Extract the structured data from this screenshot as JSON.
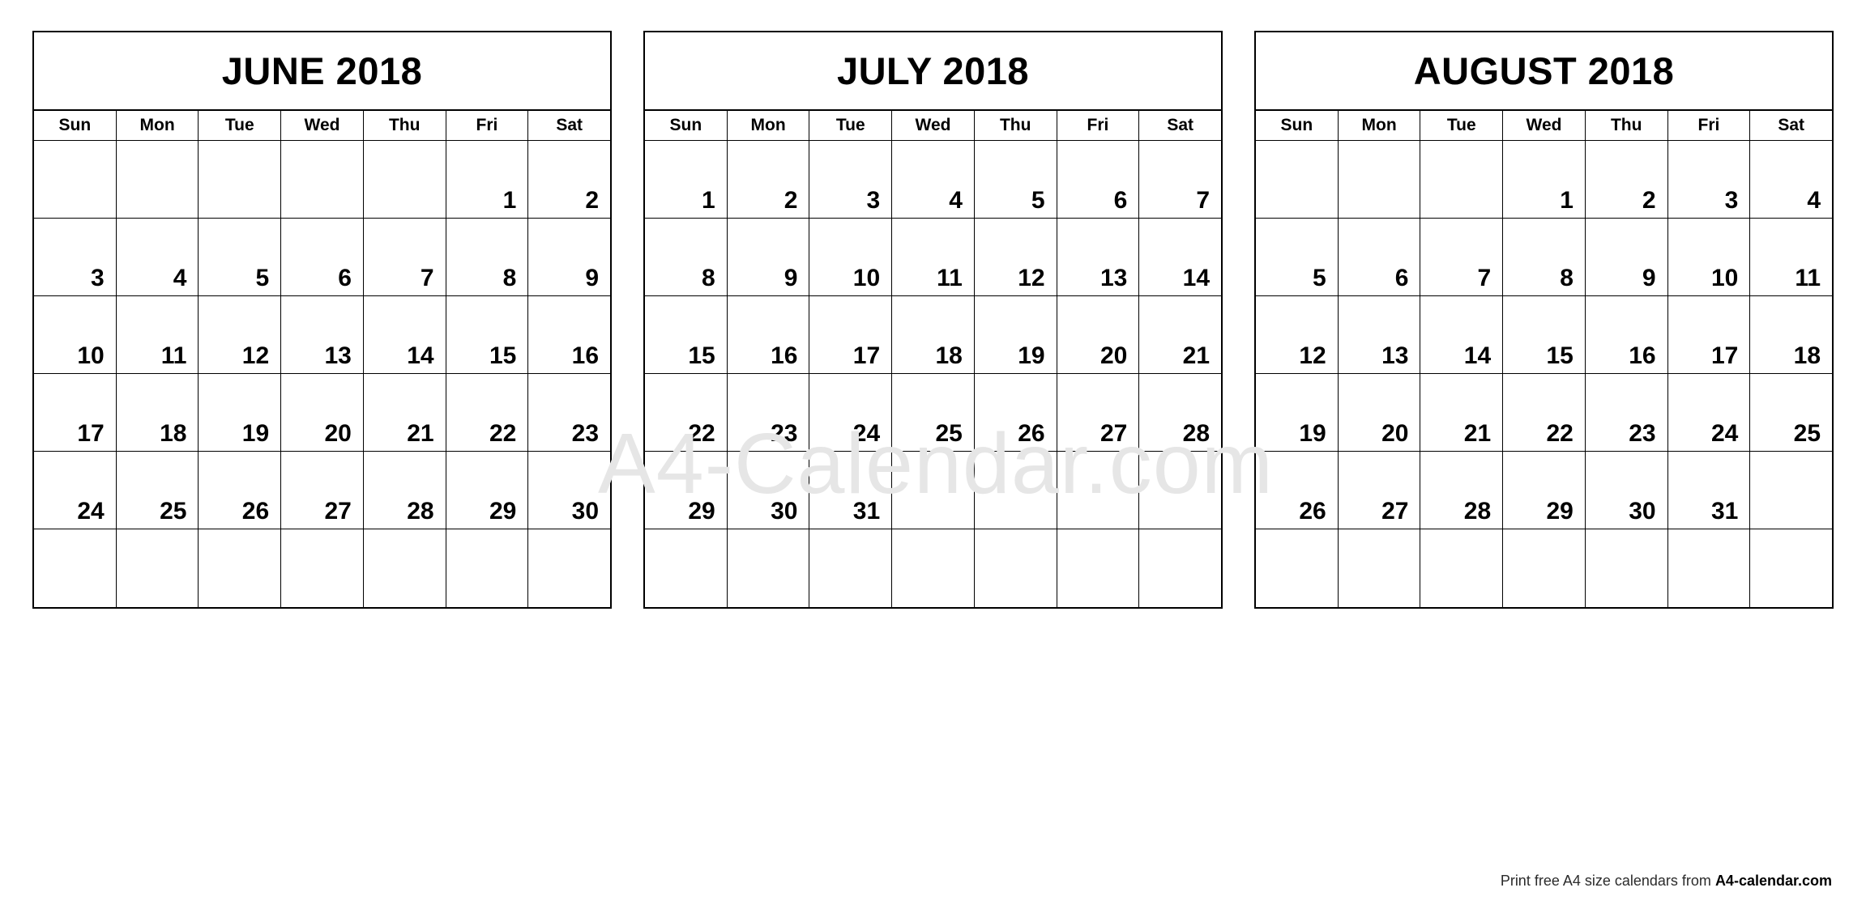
{
  "page": {
    "background_color": "#ffffff",
    "border_color": "#000000"
  },
  "watermark": {
    "text": "A4-Calendar.com",
    "color": "#e6e6e6"
  },
  "footer": {
    "prefix": "Print free A4 size calendars from ",
    "brand": "A4-calendar.com"
  },
  "weekdays": [
    "Sun",
    "Mon",
    "Tue",
    "Wed",
    "Thu",
    "Fri",
    "Sat"
  ],
  "months": [
    {
      "title": "JUNE 2018",
      "name": "June",
      "year": "2018",
      "weeks": [
        [
          "",
          "",
          "",
          "",
          "",
          "1",
          "2"
        ],
        [
          "3",
          "4",
          "5",
          "6",
          "7",
          "8",
          "9"
        ],
        [
          "10",
          "11",
          "12",
          "13",
          "14",
          "15",
          "16"
        ],
        [
          "17",
          "18",
          "19",
          "20",
          "21",
          "22",
          "23"
        ],
        [
          "24",
          "25",
          "26",
          "27",
          "28",
          "29",
          "30"
        ],
        [
          "",
          "",
          "",
          "",
          "",
          "",
          ""
        ]
      ]
    },
    {
      "title": "JULY 2018",
      "name": "July",
      "year": "2018",
      "weeks": [
        [
          "1",
          "2",
          "3",
          "4",
          "5",
          "6",
          "7"
        ],
        [
          "8",
          "9",
          "10",
          "11",
          "12",
          "13",
          "14"
        ],
        [
          "15",
          "16",
          "17",
          "18",
          "19",
          "20",
          "21"
        ],
        [
          "22",
          "23",
          "24",
          "25",
          "26",
          "27",
          "28"
        ],
        [
          "29",
          "30",
          "31",
          "",
          "",
          "",
          ""
        ],
        [
          "",
          "",
          "",
          "",
          "",
          "",
          ""
        ]
      ]
    },
    {
      "title": "AUGUST 2018",
      "name": "August",
      "year": "2018",
      "weeks": [
        [
          "",
          "",
          "",
          "1",
          "2",
          "3",
          "4"
        ],
        [
          "5",
          "6",
          "7",
          "8",
          "9",
          "10",
          "11"
        ],
        [
          "12",
          "13",
          "14",
          "15",
          "16",
          "17",
          "18"
        ],
        [
          "19",
          "20",
          "21",
          "22",
          "23",
          "24",
          "25"
        ],
        [
          "26",
          "27",
          "28",
          "29",
          "30",
          "31",
          ""
        ],
        [
          "",
          "",
          "",
          "",
          "",
          "",
          ""
        ]
      ]
    }
  ]
}
